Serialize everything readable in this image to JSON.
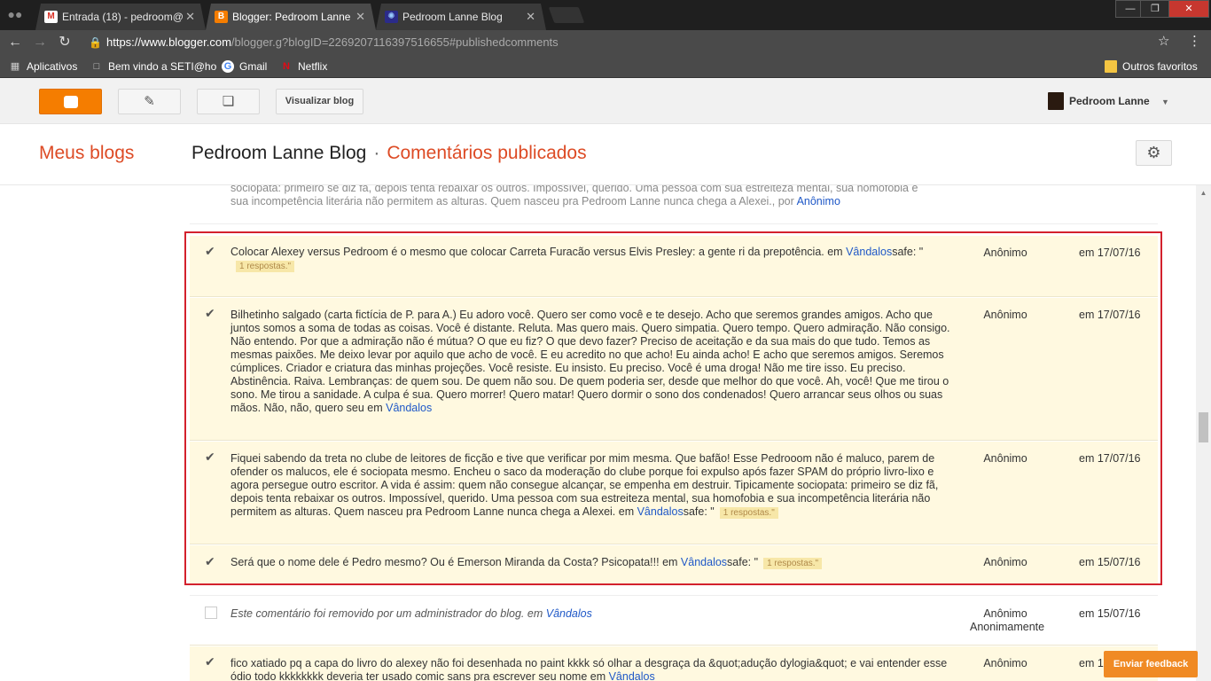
{
  "browser": {
    "tabs": [
      {
        "label": "Entrada (18) - pedroom@",
        "icon": "gmail-icon"
      },
      {
        "label": "Blogger: Pedroom Lanne",
        "icon": "blogger-icon"
      },
      {
        "label": "Pedroom Lanne Blog",
        "icon": "blog-favicon-icon"
      }
    ],
    "url_host": "https://www.blogger.com",
    "url_path": "/blogger.g?blogID=2269207116397516655#publishedcomments",
    "bookmarks": [
      {
        "label": "Aplicativos"
      },
      {
        "label": "Bem vindo a SETI@ho"
      },
      {
        "label": "Gmail"
      },
      {
        "label": "Netflix"
      }
    ],
    "other_bookmarks": "Outros favoritos"
  },
  "header": {
    "view_blog": "Visualizar blog",
    "user_name": "Pedroom Lanne"
  },
  "titlebar": {
    "my_blogs": "Meus blogs",
    "blog_name": "Pedroom Lanne Blog",
    "separator": "·",
    "section": "Comentários publicados"
  },
  "comments": {
    "partial_top": {
      "text_line1": "sociopata: primeiro se diz fã, depois tenta rebaixar os outros. Impossível, querido. Uma pessoa com sua estreiteza mental, sua homofobia e",
      "text_line2": "sua incompetência literária não permitem as alturas. Quem nasceu pra Pedroom Lanne nunca chega a Alexei., por ",
      "link": "Anônimo"
    },
    "items": [
      {
        "text": "Colocar Alexey versus Pedroom é o mesmo que colocar Carreta Furacão versus Elvis Presley: a gente ri da prepotência. em ",
        "link": "Vândalos",
        "suffix": "safe: \"",
        "replies": "1 respostas.\"",
        "author": "Anônimo",
        "date": "em 17/07/16"
      },
      {
        "text": "Bilhetinho salgado (carta fictícia de P. para A.) Eu adoro você. Quero ser como você e te desejo. Acho que seremos grandes amigos. Acho que juntos somos a soma de todas as coisas. Você é distante. Reluta. Mas quero mais. Quero simpatia. Quero tempo. Quero admiração. Não consigo. Não entendo. Por que a admiração não é mútua? O que eu fiz? O que devo fazer? Preciso de aceitação e da sua mais do que tudo. Temos as mesmas paixões. Me deixo levar por aquilo que acho de você. E eu acredito no que acho! Eu ainda acho! E acho que seremos amigos. Seremos cúmplices. Criador e criatura das minhas projeções. Você resiste. Eu insisto. Eu preciso. Você é uma droga! Não me tire isso. Eu preciso. Abstinência. Raiva. Lembranças: de quem sou. De quem não sou. De quem poderia ser, desde que melhor do que você. Ah, você! Que me tirou o sono. Me tirou a sanidade. A culpa é sua. Quero morrer! Quero matar! Quero dormir o sono dos condenados! Quero arrancar seus olhos ou suas mãos. Não, não, quero seu em ",
        "link": "Vândalos",
        "author": "Anônimo",
        "date": "em 17/07/16"
      },
      {
        "text": "Fiquei sabendo da treta no clube de leitores de ficção e tive que verificar por mim mesma. Que bafão! Esse Pedrooom não é maluco, parem de ofender os malucos, ele é sociopata mesmo. Encheu o saco da moderação do clube porque foi expulso após fazer SPAM do próprio livro-lixo e agora persegue outro escritor. A vida é assim: quem não consegue alcançar, se empenha em destruir. Tipicamente sociopata: primeiro se diz fã, depois tenta rebaixar os outros. Impossível, querido. Uma pessoa com sua estreiteza mental, sua homofobia e sua incompetência literária não permitem as alturas. Quem nasceu pra Pedroom Lanne nunca chega a Alexei. em ",
        "link": "Vândalos",
        "suffix": "safe: \"",
        "replies": "1 respostas.\"",
        "author": "Anônimo",
        "date": "em 17/07/16"
      },
      {
        "text": "Será que o nome dele é Pedro mesmo? Ou é Emerson Miranda da Costa? Psicopata!!! em ",
        "link": "Vândalos",
        "suffix": "safe: \"",
        "replies": "1 respostas.\"",
        "author": "Anônimo",
        "date": "em 15/07/16"
      }
    ],
    "removed": {
      "text": "Este comentário foi removido por um administrador do blog. em ",
      "link": "Vândalos",
      "author_line1": "Anônimo",
      "author_line2": "Anonimamente",
      "date": "em 15/07/16"
    },
    "bottom": {
      "text": "fico xatiado pq a capa do livro do alexey não foi desenhada no paint kkkk só olhar a desgraça da &quot;adução dylogia&quot; e vai entender esse ódio todo kkkkkkkk deveria ter usado comic sans pra escrever seu nome em ",
      "link": "Vândalos",
      "author": "Anônimo",
      "date": "em 1"
    }
  },
  "feedback": "Enviar feedback",
  "colors": {
    "accent": "#f57d00",
    "title_orange": "#dd4b25",
    "highlight": "#fff9e0",
    "link": "#1f58c7",
    "red_box": "#d3212d"
  }
}
